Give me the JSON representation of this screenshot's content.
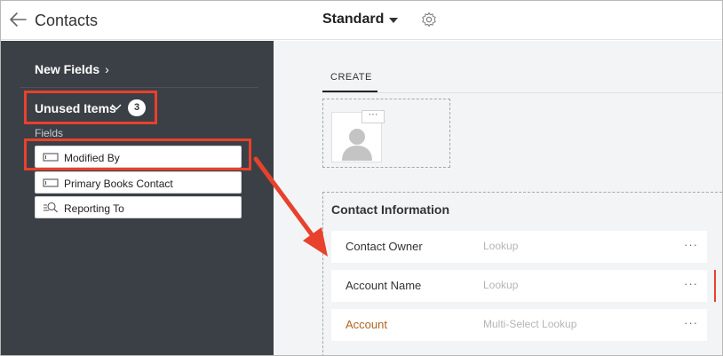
{
  "header": {
    "title": "Contacts",
    "layout_name": "Standard",
    "back_icon": "back-arrow-icon",
    "settings_icon": "gear-icon"
  },
  "sidebar": {
    "new_fields": "New Fields",
    "unused_items": "Unused Items",
    "unused_count": "3",
    "fields_heading": "Fields",
    "items": [
      {
        "label": "Modified By",
        "icon": "text-field-icon"
      },
      {
        "label": "Primary Books Contact",
        "icon": "text-field-icon"
      },
      {
        "label": "Reporting To",
        "icon": "lookup-icon"
      }
    ]
  },
  "main": {
    "tab": "CREATE",
    "photo_more": "···",
    "section_title": "Contact Information",
    "rows": [
      {
        "label": "Contact Owner",
        "type": "Lookup",
        "more": "···"
      },
      {
        "label": "Account Name",
        "type": "Lookup",
        "more": "···"
      },
      {
        "label": "Account",
        "type": "Multi-Select Lookup",
        "more": "···"
      }
    ]
  },
  "colors": {
    "sidebar_bg": "#3b4046",
    "highlight": "#e8412c",
    "account_label": "#b0651f"
  }
}
